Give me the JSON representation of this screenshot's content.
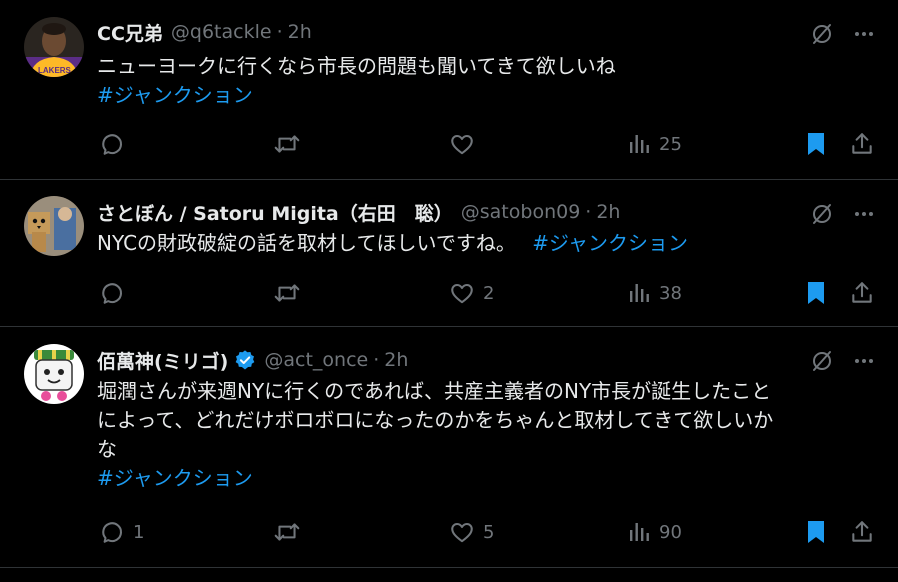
{
  "colors": {
    "background": "#000000",
    "divider": "#2f3336",
    "primary_text": "#e7e9ea",
    "secondary_text": "#71767b",
    "hashtag": "#1d9bf0",
    "bookmark_active": "#1d9bf0"
  },
  "tweets": [
    {
      "name": "CC兄弟",
      "handle": "@q6tackle",
      "dot": "·",
      "time": "2h",
      "verified": false,
      "lines": [
        "ニューヨークに行くなら市長の問題も聞いてきて欲しいね"
      ],
      "hashtag": "#ジャンクション",
      "avatar_icon": "basketball-player-avatar",
      "counts": {
        "replies": "",
        "retweets": "",
        "likes": "",
        "views": "25"
      }
    },
    {
      "name": "さとぼん / Satoru Migita（右田　聡）",
      "handle": "@satobon09",
      "dot": "·",
      "time": "2h",
      "verified": false,
      "text": "NYCの財政破綻の話を取材してほしいですね。",
      "hashtag": "#ジャンクション",
      "avatar_icon": "cardboard-robot-avatar",
      "counts": {
        "replies": "",
        "retweets": "",
        "likes": "2",
        "views": "38"
      }
    },
    {
      "name": "佰萬神(ミリゴ)",
      "handle": "@act_once",
      "dot": "·",
      "time": "2h",
      "verified": true,
      "lines": [
        "堀潤さんが来週NYに行くのであれば、共産主義者のNY市長が誕生したこと",
        "によって、どれだけボロボロになったのかをちゃんと取材してきて欲しいか",
        "な"
      ],
      "hashtag": "#ジャンクション",
      "avatar_icon": "mascot-character-avatar",
      "counts": {
        "replies": "1",
        "retweets": "",
        "likes": "5",
        "views": "90"
      }
    }
  ],
  "icons": {
    "grok": "grok-icon",
    "more": "more-icon",
    "reply": "reply-icon",
    "retweet": "retweet-icon",
    "like": "like-icon",
    "views": "views-icon",
    "bookmark": "bookmark-icon",
    "share": "share-icon"
  }
}
